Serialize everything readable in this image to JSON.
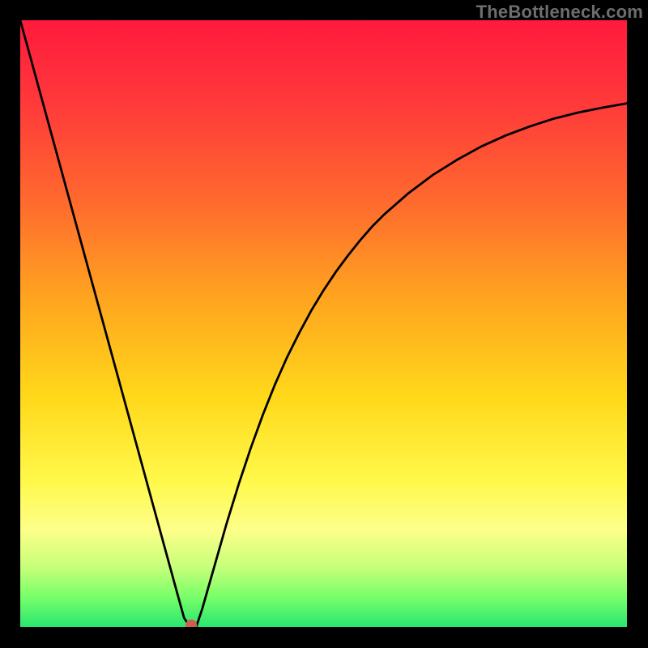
{
  "watermark": "TheBottleneck.com",
  "chart_data": {
    "type": "line",
    "title": "",
    "xlabel": "",
    "ylabel": "",
    "xlim": [
      0,
      100
    ],
    "ylim": [
      0,
      100
    ],
    "x": [
      0,
      2,
      4,
      6,
      8,
      10,
      12,
      14,
      16,
      18,
      20,
      22,
      24,
      26,
      27,
      28,
      29,
      30,
      32,
      34,
      36,
      38,
      40,
      42,
      44,
      46,
      48,
      50,
      52,
      54,
      56,
      58,
      60,
      64,
      68,
      72,
      76,
      80,
      84,
      88,
      92,
      96,
      100
    ],
    "values": [
      100,
      92.7,
      85.4,
      78.1,
      70.8,
      63.5,
      56.2,
      48.9,
      41.6,
      34.3,
      27.0,
      19.7,
      12.4,
      5.1,
      1.5,
      0.0,
      0.0,
      3.0,
      10.0,
      17.0,
      23.5,
      29.5,
      35.0,
      40.0,
      44.5,
      48.5,
      52.2,
      55.5,
      58.5,
      61.2,
      63.7,
      66.0,
      68.0,
      71.5,
      74.5,
      77.0,
      79.2,
      81.0,
      82.5,
      83.8,
      84.8,
      85.6,
      86.3
    ],
    "marker": {
      "x": 28.2,
      "y": 0.3,
      "color": "#cc5e53"
    },
    "colors": {
      "line": "#000000",
      "background_gradient": [
        "#ff1a3d",
        "#29e66f"
      ]
    }
  }
}
